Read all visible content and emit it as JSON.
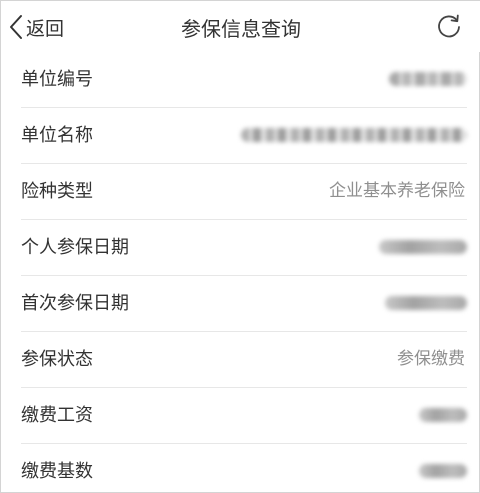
{
  "header": {
    "back_label": "返回",
    "title": "参保信息查询",
    "back_icon": "chevron-left-icon",
    "refresh_icon": "refresh-icon"
  },
  "rows": [
    {
      "label": "单位编号",
      "value": "",
      "redacted": true
    },
    {
      "label": "单位名称",
      "value": "",
      "redacted": true
    },
    {
      "label": "险种类型",
      "value": "企业基本养老保险",
      "redacted": false
    },
    {
      "label": "个人参保日期",
      "value": "",
      "redacted": true
    },
    {
      "label": "首次参保日期",
      "value": "",
      "redacted": true
    },
    {
      "label": "参保状态",
      "value": "参保缴费",
      "redacted": false
    },
    {
      "label": "缴费工资",
      "value": "",
      "redacted": true
    },
    {
      "label": "缴费基数",
      "value": "",
      "redacted": true
    }
  ],
  "colors": {
    "label_text": "#333333",
    "value_text": "#8f8f8f",
    "divider": "#e7e7e7",
    "background": "#ffffff"
  }
}
